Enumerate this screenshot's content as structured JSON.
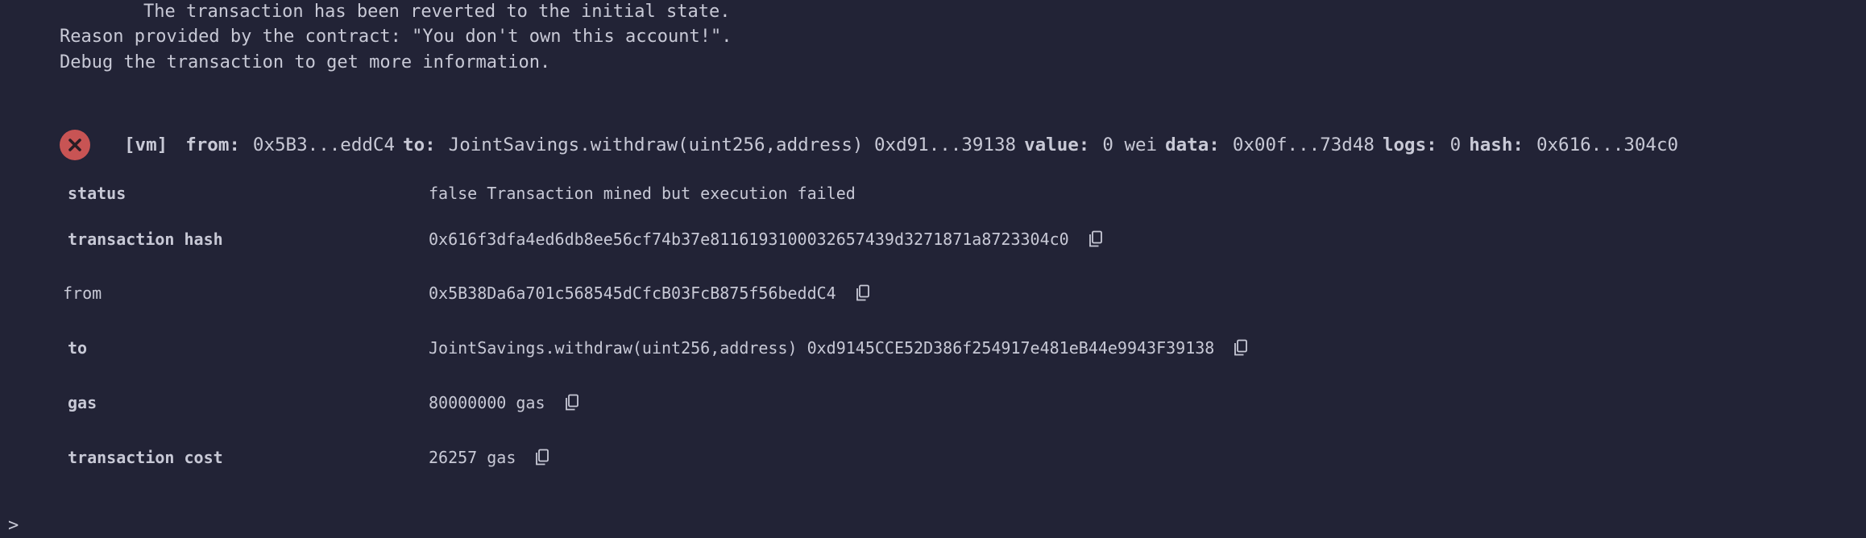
{
  "error_message": {
    "line1": "The transaction has been reverted to the initial state.",
    "line2": "Reason provided by the contract: \"You don't own this account!\".",
    "line3": "Debug the transaction to get more information."
  },
  "summary": {
    "tag": "[vm]",
    "from_key": "from:",
    "from_val": "0x5B3...eddC4",
    "to_key": "to:",
    "to_val": "JointSavings.withdraw(uint256,address) 0xd91...39138",
    "value_key": "value:",
    "value_val": "0 wei",
    "data_key": "data:",
    "data_val": "0x00f...73d48",
    "logs_key": "logs:",
    "logs_val": "0",
    "hash_key": "hash:",
    "hash_val": "0x616...304c0"
  },
  "details": {
    "status_label": "status",
    "status_value": "false Transaction mined but execution failed",
    "tx_hash_label": "transaction hash",
    "tx_hash_value": "0x616f3dfa4ed6db8ee56cf74b37e8116193100032657439d3271871a8723304c0",
    "from_label": "from",
    "from_value": "0x5B38Da6a701c568545dCfcB03FcB875f56beddC4",
    "to_label": "to",
    "to_value": "JointSavings.withdraw(uint256,address) 0xd9145CCE52D386f254917e481eB44e9943F39138",
    "gas_label": "gas",
    "gas_value": "80000000 gas",
    "cost_label": "transaction cost",
    "cost_value": "26257 gas"
  },
  "prompt": ">",
  "icons": {
    "fail": "x-circle-icon",
    "copy": "copy-icon"
  },
  "colors": {
    "background": "#222336",
    "text": "#c8c9d6",
    "error_icon": "#c85454"
  }
}
